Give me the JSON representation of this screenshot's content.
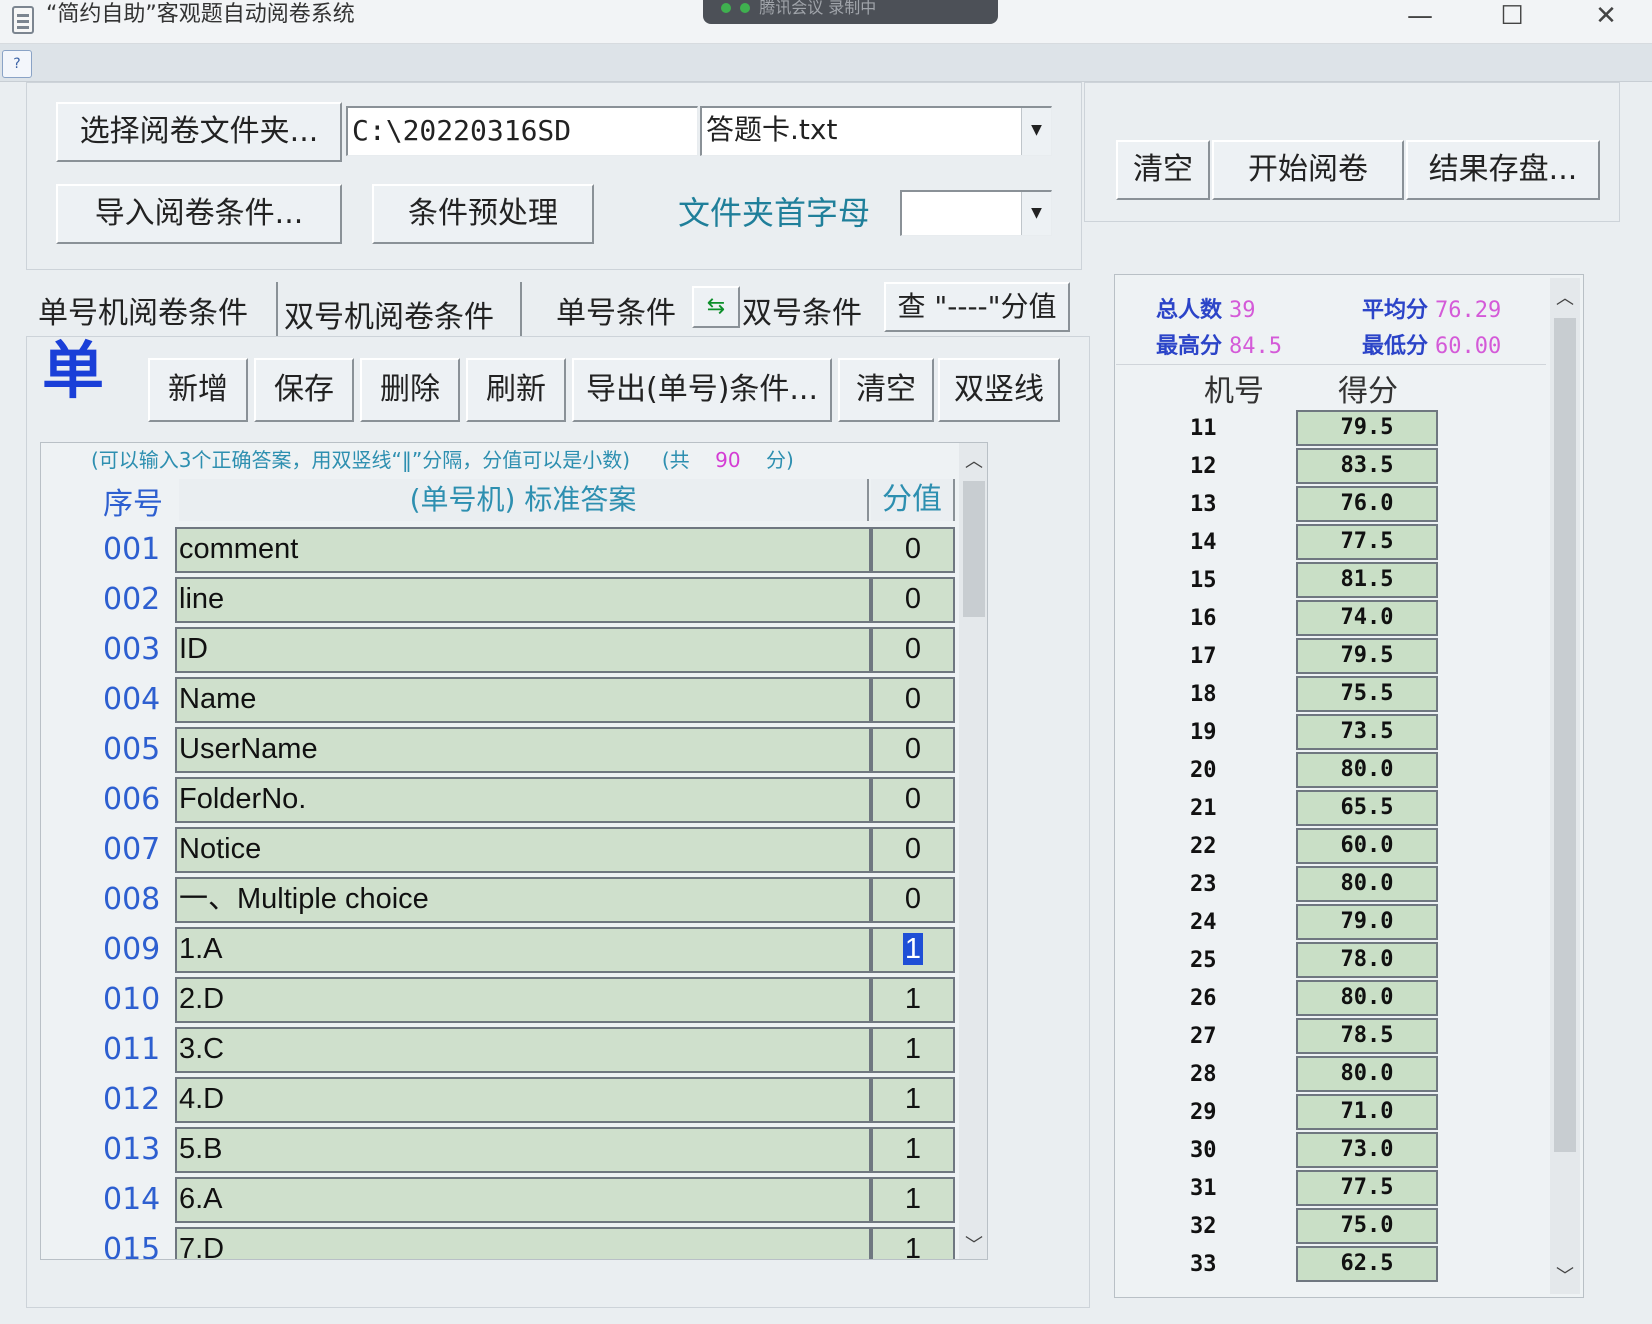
{
  "window": {
    "title": "“简约自助”客观题自动阅卷系统",
    "meeting_bar": "腾讯会议  录制中",
    "minimize": "—",
    "maximize": "☐",
    "close": "✕"
  },
  "menubar": {
    "help": "?"
  },
  "top": {
    "select_folder_btn": "选择阅卷文件夹...",
    "folder_path": "C:\\20220316SD",
    "answer_file": "答题卡.txt",
    "import_conditions_btn": "导入阅卷条件...",
    "preprocess_btn": "条件预处理",
    "folder_initial_label": "文件夹首字母",
    "folder_initial_value": ""
  },
  "right_toolbar": {
    "clear_btn": "清空",
    "start_btn": "开始阅卷",
    "save_btn": "结果存盘..."
  },
  "tabs": {
    "single_tab": "单号机阅卷条件",
    "double_tab": "双号机阅卷条件",
    "single_cond": "单号条件",
    "double_cond": "双号条件",
    "query_btn": "查 \"----\"分值"
  },
  "actions": {
    "mode_char": "单",
    "add": "新增",
    "save": "保存",
    "delete": "删除",
    "refresh": "刷新",
    "export": "导出(单号)条件...",
    "clear": "清空",
    "double_bar": "双竖线"
  },
  "grid": {
    "hint": "(可以输入3个正确答案，用双竖线“‖”分隔，分值可以是小数)",
    "total_prefix": "(共",
    "total_value": "90",
    "total_suffix": "分)",
    "col_seq": "序号",
    "col_answer": "(单号机)  标准答案",
    "col_score": "分值",
    "rows": [
      {
        "seq": "001",
        "answer": "comment",
        "score": "0"
      },
      {
        "seq": "002",
        "answer": "line",
        "score": "0"
      },
      {
        "seq": "003",
        "answer": "ID",
        "score": "0"
      },
      {
        "seq": "004",
        "answer": "Name",
        "score": "0"
      },
      {
        "seq": "005",
        "answer": "UserName",
        "score": "0"
      },
      {
        "seq": "006",
        "answer": "FolderNo.",
        "score": "0"
      },
      {
        "seq": "007",
        "answer": "Notice",
        "score": "0"
      },
      {
        "seq": "008",
        "answer": "一、Multiple choice",
        "score": "0"
      },
      {
        "seq": "009",
        "answer": "1.A",
        "score": "1"
      },
      {
        "seq": "010",
        "answer": "2.D",
        "score": "1"
      },
      {
        "seq": "011",
        "answer": "3.C",
        "score": "1"
      },
      {
        "seq": "012",
        "answer": "4.D",
        "score": "1"
      },
      {
        "seq": "013",
        "answer": "5.B",
        "score": "1"
      },
      {
        "seq": "014",
        "answer": "6.A",
        "score": "1"
      },
      {
        "seq": "015",
        "answer": "7.D",
        "score": "1"
      }
    ]
  },
  "results": {
    "total_label": "总人数",
    "total_value": "39",
    "avg_label": "平均分",
    "avg_value": "76.29",
    "max_label": "最高分",
    "max_value": "84.5",
    "min_label": "最低分",
    "min_value": "60.00",
    "col_no": "机号",
    "col_score": "得分",
    "rows": [
      {
        "no": "11",
        "score": "79.5"
      },
      {
        "no": "12",
        "score": "83.5"
      },
      {
        "no": "13",
        "score": "76.0"
      },
      {
        "no": "14",
        "score": "77.5"
      },
      {
        "no": "15",
        "score": "81.5"
      },
      {
        "no": "16",
        "score": "74.0"
      },
      {
        "no": "17",
        "score": "79.5"
      },
      {
        "no": "18",
        "score": "75.5"
      },
      {
        "no": "19",
        "score": "73.5"
      },
      {
        "no": "20",
        "score": "80.0"
      },
      {
        "no": "21",
        "score": "65.5"
      },
      {
        "no": "22",
        "score": "60.0"
      },
      {
        "no": "23",
        "score": "80.0"
      },
      {
        "no": "24",
        "score": "79.0"
      },
      {
        "no": "25",
        "score": "78.0"
      },
      {
        "no": "26",
        "score": "80.0"
      },
      {
        "no": "27",
        "score": "78.5"
      },
      {
        "no": "28",
        "score": "80.0"
      },
      {
        "no": "29",
        "score": "71.0"
      },
      {
        "no": "30",
        "score": "73.0"
      },
      {
        "no": "31",
        "score": "77.5"
      },
      {
        "no": "32",
        "score": "75.0"
      },
      {
        "no": "33",
        "score": "62.5"
      }
    ]
  }
}
